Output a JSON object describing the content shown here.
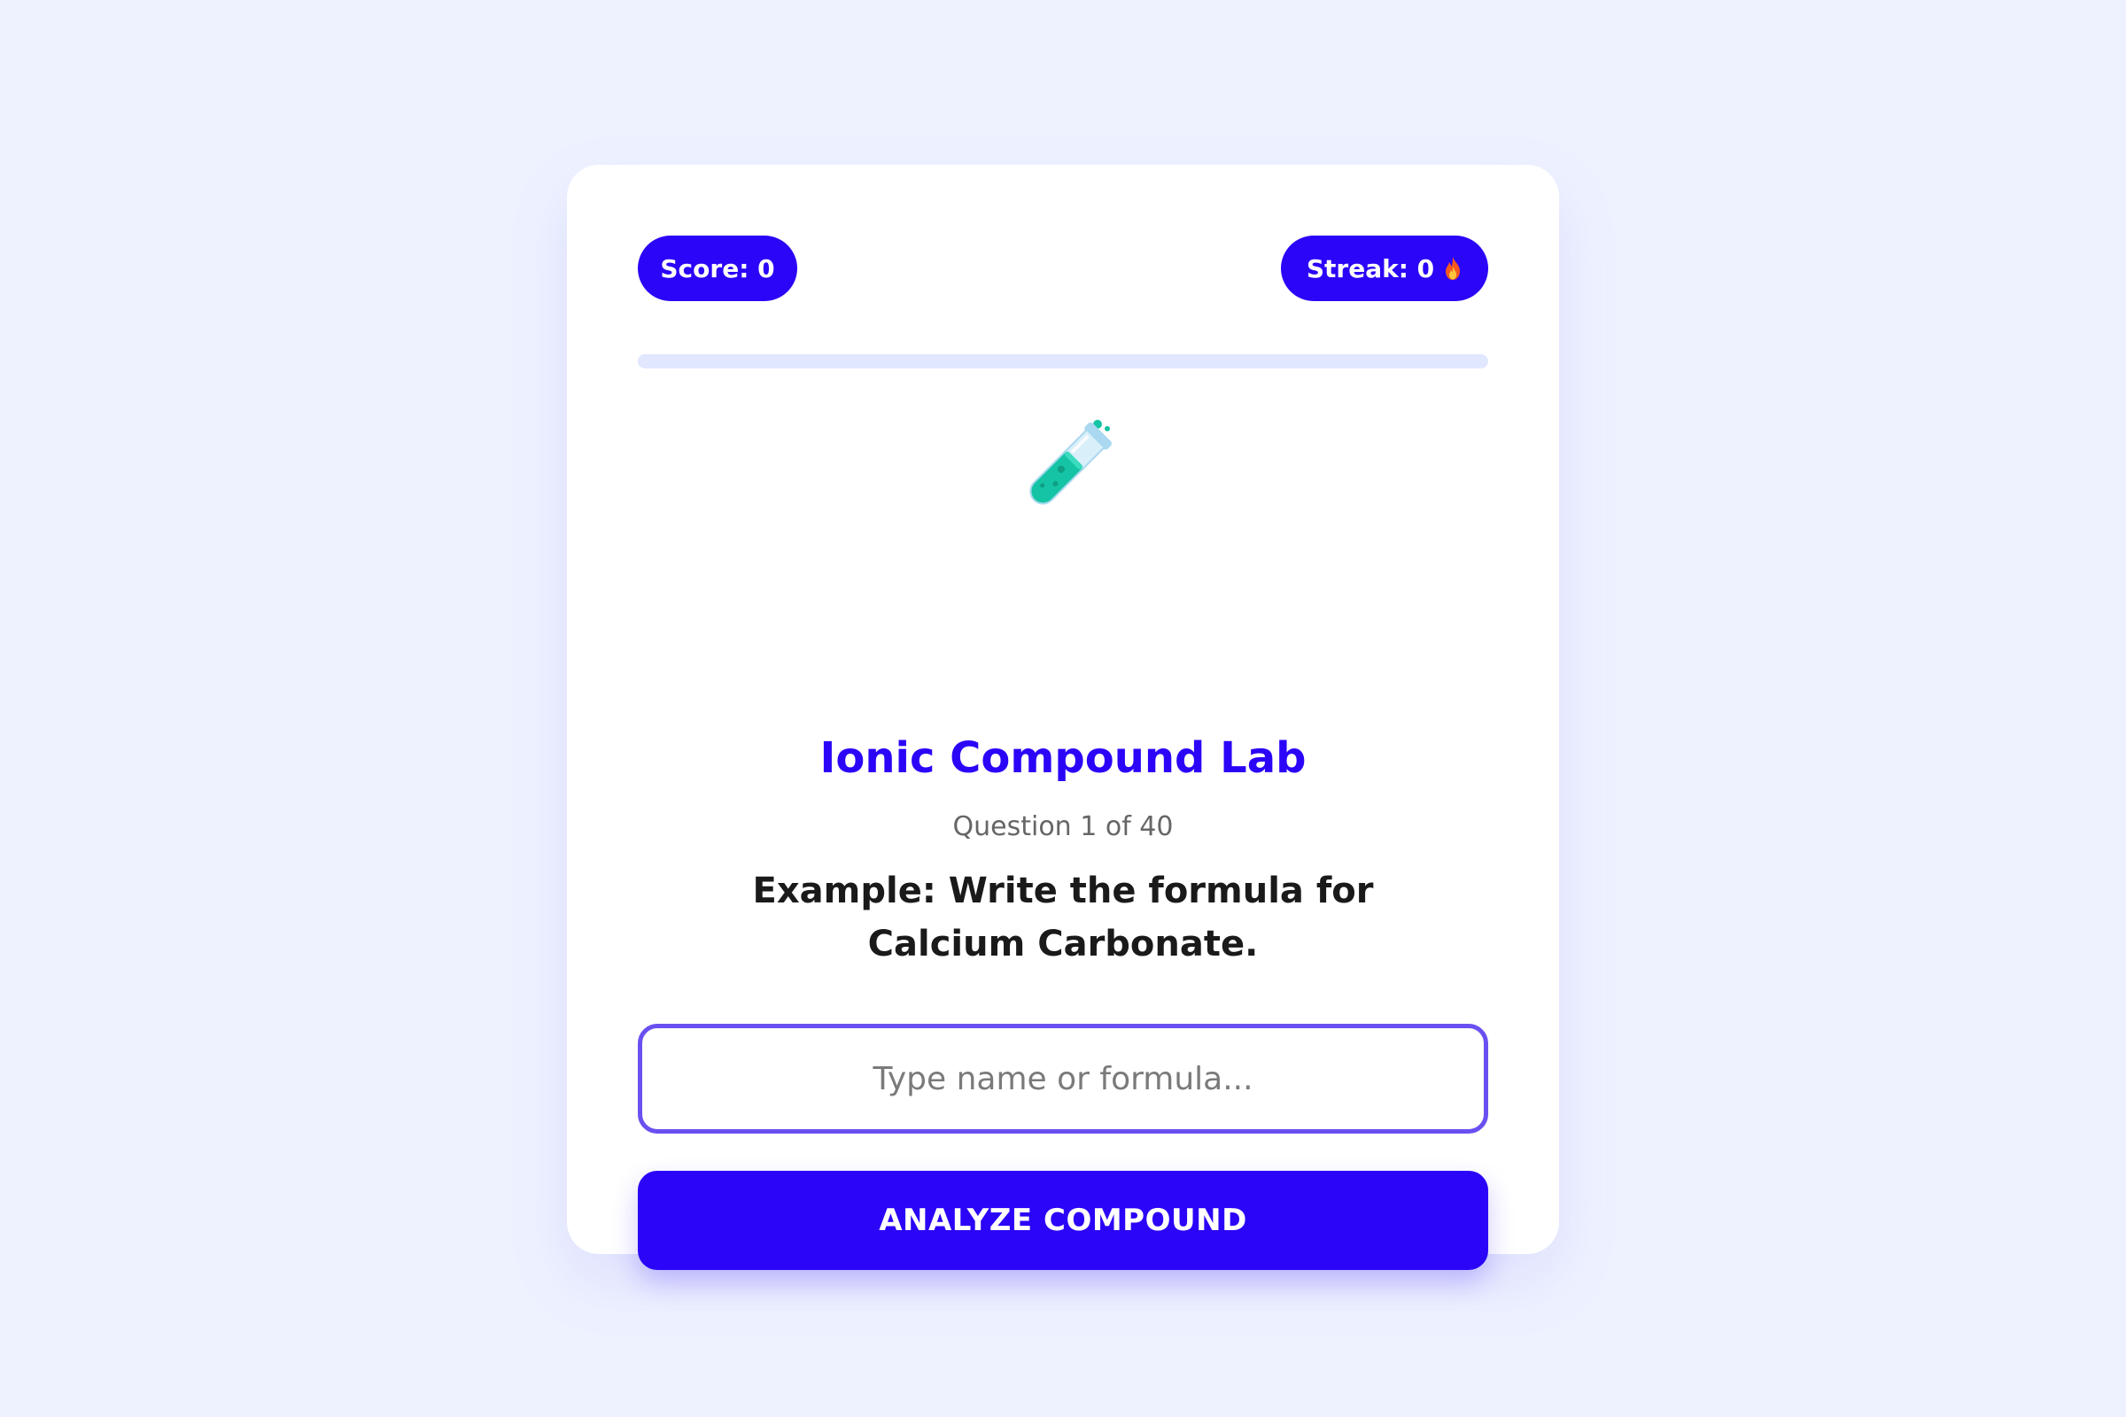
{
  "stats": {
    "score_label": "Score: 0",
    "streak_label": "Streak: 0",
    "streak_icon": "fire-icon"
  },
  "progress": {
    "fraction": 0
  },
  "hero": {
    "icon": "test-tube-icon",
    "title": "Ionic Compound Lab",
    "counter": "Question 1 of 40",
    "question": "Example: Write the formula for Calcium Carbonate."
  },
  "answer": {
    "value": "",
    "placeholder": "Type name or formula..."
  },
  "actions": {
    "submit_label": "ANALYZE COMPOUND"
  },
  "colors": {
    "background": "#eef2ff",
    "accent": "#2a05f7",
    "input_border": "#6950f0",
    "progress_track": "#e0e7ff",
    "test_tube_liquid": "#14c4a4"
  }
}
